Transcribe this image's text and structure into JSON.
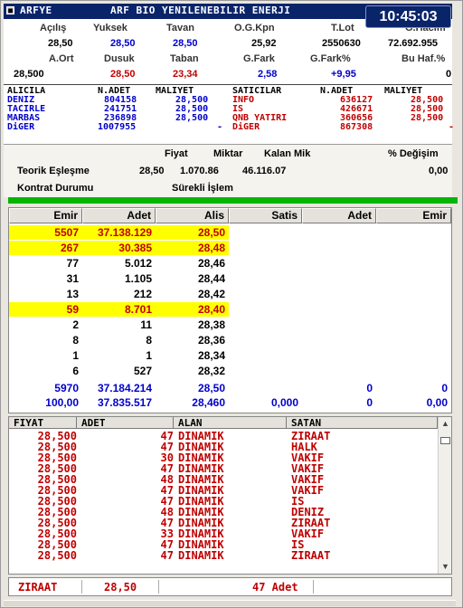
{
  "window": {
    "symbol": "ARFYE",
    "name": "ARF BIO YENILENEBILIR ENERJI",
    "clock": "10:45:03",
    "colors": {
      "titlebar": "#0a246a",
      "highlight": "#ffff00",
      "blue_values": "#0000cc",
      "red_values": "#c00000",
      "green_bar": "#05b505"
    }
  },
  "stats": {
    "row1_labels": [
      "Açılış",
      "Yuksek",
      "Tavan",
      "O.G.Kpn",
      "T.Lot",
      "G.Hacim"
    ],
    "row1_values": [
      "28,50",
      "28,50",
      "28,50",
      "25,92",
      "2550630",
      "72.692.955"
    ],
    "row2_labels": [
      "A.Ort",
      "Dusuk",
      "Taban",
      "G.Fark",
      "G.Fark%",
      "Bu Haf.%"
    ],
    "row2_values": [
      "28,500",
      "28,50",
      "23,34",
      "2,58",
      "+9,95",
      "0"
    ]
  },
  "depth": {
    "headers": [
      "ALICILA",
      "N.ADET",
      "MALIYET",
      "SATICILAR",
      "N.ADET",
      "MALIYET"
    ],
    "rows": [
      [
        "DENIZ",
        "804158",
        "28,500",
        "INFO",
        "636127",
        "28,500"
      ],
      [
        "TACIRLE",
        "241751",
        "28,500",
        "IS",
        "426671",
        "28,500"
      ],
      [
        "MARBAS",
        "236898",
        "28,500",
        "QNB YATIRI",
        "360656",
        "28,500"
      ],
      [
        "DiGER",
        "1007955",
        "-",
        "DiGER",
        "867308",
        "-"
      ]
    ]
  },
  "info": {
    "headers": [
      "Fiyat",
      "Miktar",
      "Kalan Mik",
      "% Değişim"
    ],
    "teorik_label": "Teorik Eşleşme",
    "teorik_values": [
      "28,50",
      "1.070.86",
      "46.116.07",
      "0,00"
    ],
    "kontrat_label": "Kontrat Durumu",
    "kontrat_value": "Sürekli İşlem"
  },
  "orderbook": {
    "headers": [
      "Emir",
      "Adet",
      "Alis",
      "Satis",
      "Adet",
      "Emir"
    ],
    "rows": [
      {
        "emir": "5507",
        "adet": "37.138.129",
        "alis": "28,50",
        "hl": true
      },
      {
        "emir": "267",
        "adet": "30.385",
        "alis": "28,48",
        "hl": true
      },
      {
        "emir": "77",
        "adet": "5.012",
        "alis": "28,46",
        "hl": false
      },
      {
        "emir": "31",
        "adet": "1.105",
        "alis": "28,44",
        "hl": false
      },
      {
        "emir": "13",
        "adet": "212",
        "alis": "28,42",
        "hl": false
      },
      {
        "emir": "59",
        "adet": "8.701",
        "alis": "28,40",
        "hl": true
      },
      {
        "emir": "2",
        "adet": "11",
        "alis": "28,38",
        "hl": false
      },
      {
        "emir": "8",
        "adet": "8",
        "alis": "28,36",
        "hl": false
      },
      {
        "emir": "1",
        "adet": "1",
        "alis": "28,34",
        "hl": false
      },
      {
        "emir": "6",
        "adet": "527",
        "alis": "28,32",
        "hl": false
      }
    ],
    "total1": [
      "5970",
      "37.184.214",
      "28,50",
      "",
      "0",
      "0"
    ],
    "total2": [
      "100,00",
      "37.835.517",
      "28,460",
      "0,000",
      "0",
      "0,00"
    ]
  },
  "trades": {
    "headers": [
      "FIYAT",
      "ADET",
      "ALAN",
      "SATAN"
    ],
    "rows": [
      [
        "28,500",
        "47",
        "DINAMIK",
        "ZIRAAT"
      ],
      [
        "28,500",
        "47",
        "DINAMIK",
        "HALK"
      ],
      [
        "28,500",
        "30",
        "DINAMIK",
        "VAKIF"
      ],
      [
        "28,500",
        "47",
        "DINAMIK",
        "VAKIF"
      ],
      [
        "28,500",
        "48",
        "DINAMIK",
        "VAKIF"
      ],
      [
        "28,500",
        "47",
        "DINAMIK",
        "VAKIF"
      ],
      [
        "28,500",
        "47",
        "DINAMIK",
        "IS"
      ],
      [
        "28,500",
        "48",
        "DINAMIK",
        "DENIZ"
      ],
      [
        "28,500",
        "47",
        "DINAMIK",
        "ZIRAAT"
      ],
      [
        "28,500",
        "33",
        "DINAMIK",
        "VAKIF"
      ],
      [
        "28,500",
        "47",
        "DINAMIK",
        "IS"
      ],
      [
        "28,500",
        "47",
        "DINAMIK",
        "ZIRAAT"
      ]
    ]
  },
  "status": {
    "broker": "ZIRAAT",
    "price": "28,50",
    "qty": "47 Adet"
  }
}
